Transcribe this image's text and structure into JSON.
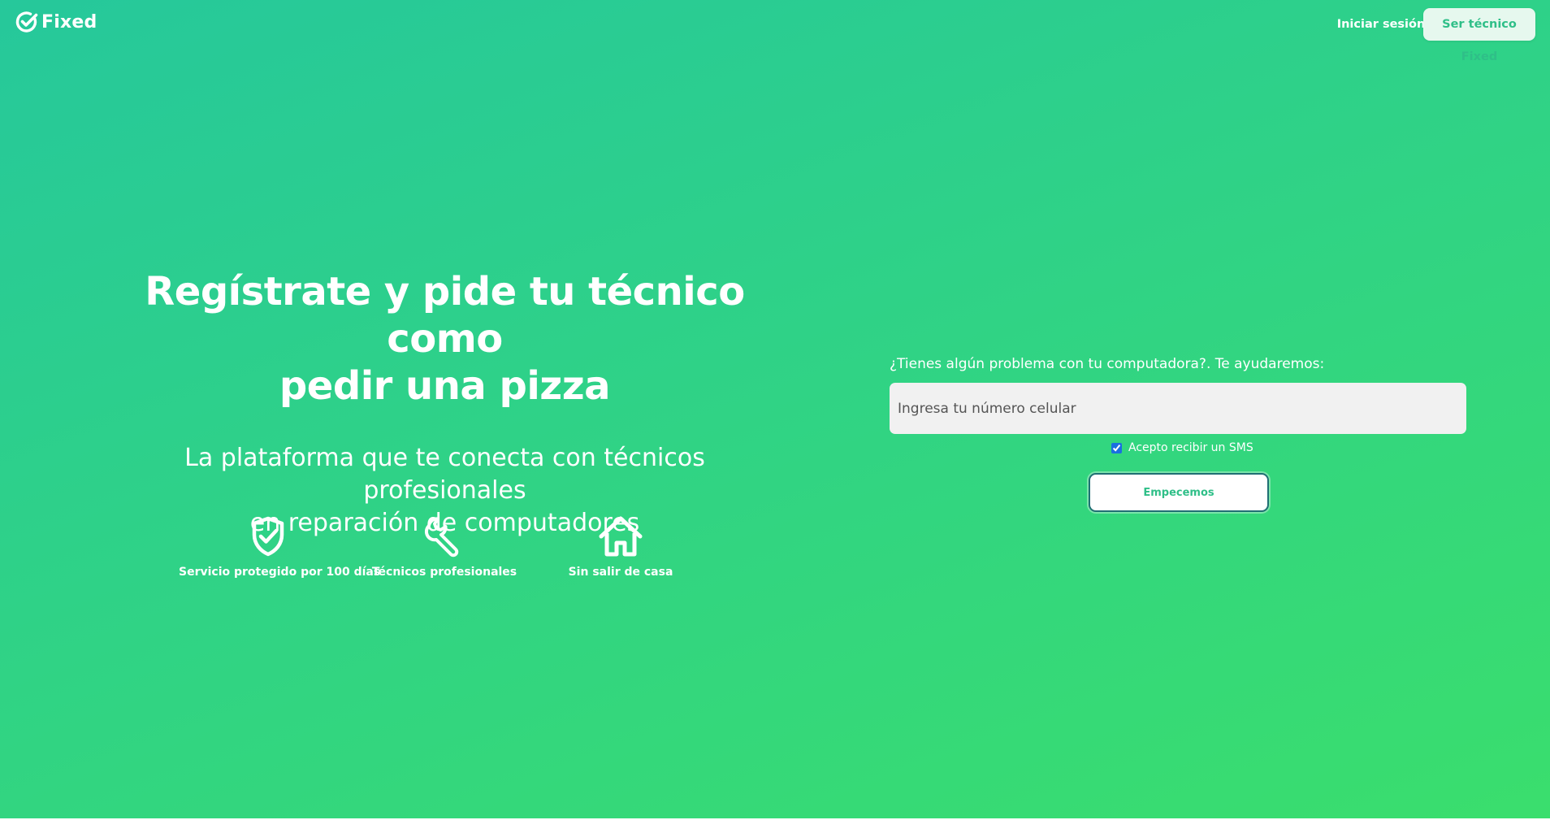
{
  "header": {
    "brand_name": "Fixed",
    "brand_icon": "check-circle-icon",
    "login_label": "Iniciar sesión",
    "become_tech_label": "Ser técnico Fixed"
  },
  "hero": {
    "headline_line1": "Regístrate y pide tu técnico como",
    "headline_line2": "pedir una pizza",
    "subheadline_line1": "La plataforma que te conecta con técnicos profesionales",
    "subheadline_line2": "en reparación de computadores"
  },
  "features": [
    {
      "icon": "shield-check-icon",
      "label": "Servicio protegido por 100 días"
    },
    {
      "icon": "wrench-icon",
      "label": "Técnicos profesionales"
    },
    {
      "icon": "house-icon",
      "label": "Sin salir de casa"
    }
  ],
  "form": {
    "prompt": "¿Tienes algún problema con tu computadora?. Te ayudaremos:",
    "phone_placeholder": "Ingresa tu número celular",
    "phone_value": "",
    "sms_label": "Acepto recibir un SMS",
    "sms_checked": true,
    "submit_label": "Empecemos"
  },
  "colors": {
    "gradient_start": "#26c89b",
    "gradient_end": "#3ade6d",
    "accent_text": "#2fbf88",
    "input_bg": "#f1f1f1"
  }
}
